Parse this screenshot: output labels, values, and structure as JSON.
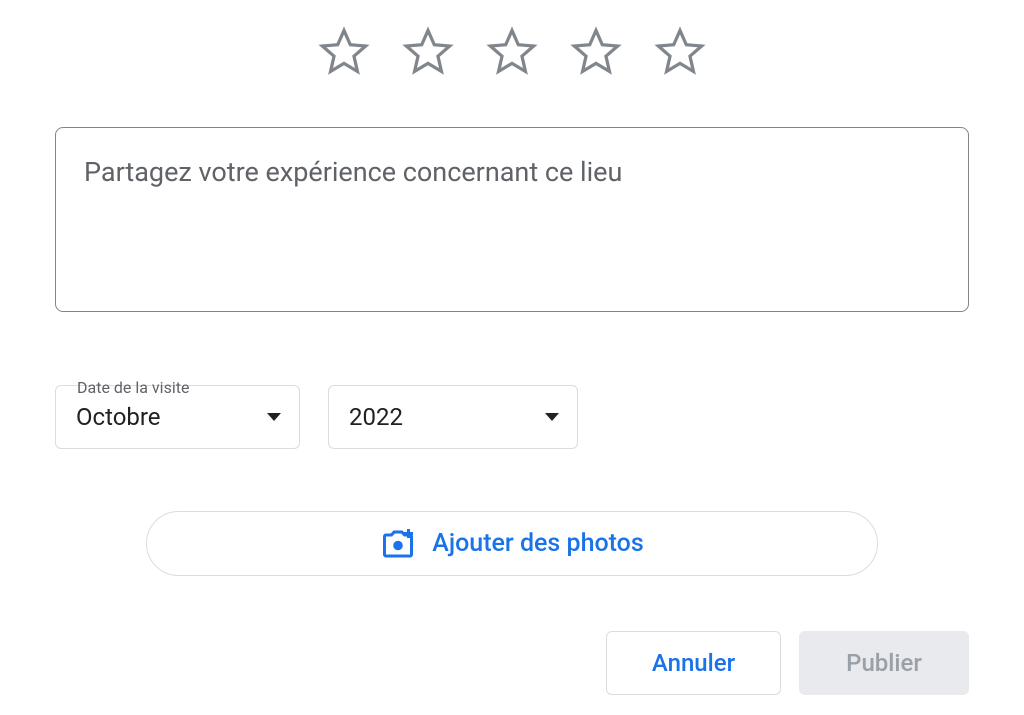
{
  "rating": {
    "stars": 5,
    "selected": 0
  },
  "review": {
    "placeholder": "Partagez votre expérience concernant ce lieu",
    "value": ""
  },
  "visitDate": {
    "label": "Date de la visite",
    "month": {
      "selected": "Octobre"
    },
    "year": {
      "selected": "2022"
    }
  },
  "addPhotos": {
    "label": "Ajouter des photos",
    "iconName": "camera-add-icon"
  },
  "actions": {
    "cancel": "Annuler",
    "publish": "Publier"
  }
}
